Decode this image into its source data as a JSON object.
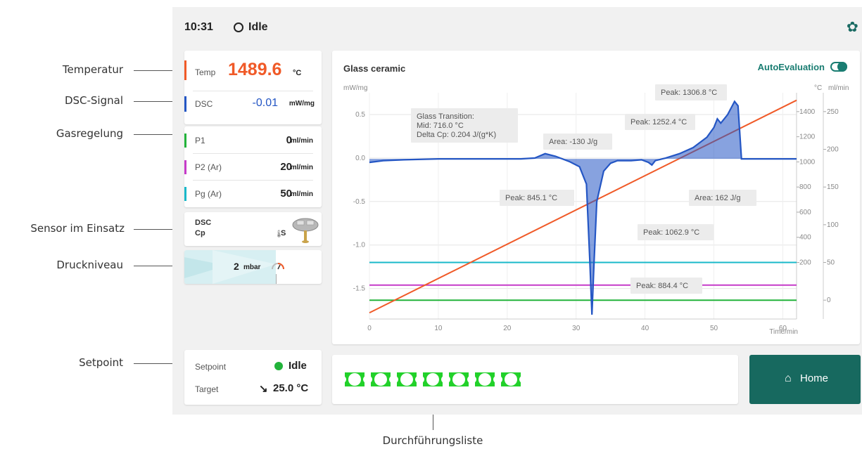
{
  "annotations": {
    "temperatur": "Temperatur",
    "dsc_signal": "DSC-Signal",
    "gasregelung": "Gasregelung",
    "sensor": "Sensor im Einsatz",
    "druckniveau": "Druckniveau",
    "setpoint": "Setpoint",
    "durchfuehrungsliste": "Durchführungsliste"
  },
  "status": {
    "time": "10:31",
    "state": "Idle",
    "settings_icon": "gear-icon"
  },
  "temp": {
    "label": "Temp",
    "value": "1489.6",
    "unit": "°C",
    "color": "#f05a28"
  },
  "dsc": {
    "label": "DSC",
    "value": "-0.01",
    "unit": "mW/mg",
    "color": "#2456c4"
  },
  "gas": [
    {
      "label": "P1",
      "value": "0",
      "unit": "ml/min",
      "color": "#22b33a"
    },
    {
      "label": "P2 (Ar)",
      "value": "20",
      "unit": "ml/min",
      "color": "#c63bc9"
    },
    {
      "label": "Pg (Ar)",
      "value": "50",
      "unit": "ml/min",
      "color": "#19b8c9"
    }
  ],
  "sensor": {
    "line1": "DSC",
    "line2": "Cp",
    "type": "S",
    "thermo_icon": "thermometer-icon"
  },
  "pressure": {
    "value": "2",
    "unit": "mbar",
    "gauge_icon": "gauge-icon"
  },
  "setpoint": {
    "label": "Setpoint",
    "status": "Idle",
    "status_color": "#22b33a",
    "target_label": "Target",
    "target_value": "25.0 °C",
    "arrow": "↘"
  },
  "chart": {
    "title": "Glass ceramic",
    "auto_eval": "AutoEvaluation",
    "auto_eval_on": true
  },
  "chart_data": {
    "type": "line",
    "xlabel": "Time/min",
    "ylabel_left": "mW/mg",
    "ylabel_right_1": "°C",
    "ylabel_right_2": "ml/min",
    "xlim": [
      0,
      62
    ],
    "ylim_left": [
      -1.85,
      0.75
    ],
    "ylim_right_1": [
      -250,
      1550
    ],
    "ylim_right_2": [
      -25,
      275
    ],
    "x_ticks": [
      "0",
      "10",
      "20",
      "30",
      "40",
      "50",
      "60"
    ],
    "y_ticks_left": [
      "0.5",
      "0.0",
      "-0.5",
      "-1.0",
      "-1.5"
    ],
    "y_ticks_right_1": [
      "1400",
      "1200",
      "1000",
      "800",
      "600",
      "400",
      "200"
    ],
    "y_ticks_right_2": [
      "250",
      "200",
      "150",
      "100",
      "50",
      "0"
    ],
    "grid": true,
    "series": [
      {
        "color": "#2456c4",
        "axis": "left",
        "x": [
          0,
          2,
          5,
          10,
          15,
          20,
          22,
          24,
          25.5,
          27,
          29,
          30.5,
          31.5,
          32,
          32.3,
          32.6,
          33,
          34,
          35,
          36,
          38,
          39.5,
          40.5,
          41,
          41.5,
          43,
          45,
          47,
          49,
          50,
          50.5,
          51,
          52,
          53,
          53.5,
          54,
          56,
          60,
          62
        ],
        "y": [
          -0.05,
          -0.03,
          -0.02,
          -0.01,
          -0.01,
          -0.01,
          -0.01,
          0.0,
          0.05,
          0.02,
          -0.04,
          -0.1,
          -0.3,
          -1.2,
          -1.8,
          -1.2,
          -0.5,
          -0.15,
          -0.06,
          -0.03,
          -0.03,
          -0.02,
          -0.05,
          -0.08,
          -0.03,
          0.0,
          0.05,
          0.12,
          0.24,
          0.35,
          0.45,
          0.4,
          0.5,
          0.65,
          0.6,
          -0.01,
          -0.01,
          -0.01,
          -0.01
        ]
      },
      {
        "color": "#f05a28",
        "axis": "right_1",
        "x": [
          0,
          62
        ],
        "y": [
          -200,
          1490
        ]
      },
      {
        "color": "#19b8c9",
        "axis": "right_2",
        "x": [
          0,
          62
        ],
        "y": [
          50,
          50
        ]
      },
      {
        "color": "#c63bc9",
        "axis": "right_2",
        "x": [
          0,
          62
        ],
        "y": [
          20,
          20
        ]
      },
      {
        "color": "#22b33a",
        "axis": "right_2",
        "x": [
          0,
          62
        ],
        "y": [
          0,
          0
        ]
      }
    ],
    "fill": "#2456c4",
    "annotations": [
      {
        "text": "Glass Transition:\nMid: 716.0 °C\nDelta Cp: 0.204 J/(g*K)"
      },
      {
        "text": "Area: -130 J/g"
      },
      {
        "text": "Peak: 1252.4 °C"
      },
      {
        "text": "Peak: 1306.8 °C"
      },
      {
        "text": "Peak: 845.1 °C"
      },
      {
        "text": "Area: 162 J/g"
      },
      {
        "text": "Peak: 1062.9 °C"
      },
      {
        "text": "Peak: 884.4 °C"
      }
    ]
  },
  "queue": {
    "count": 7,
    "color": "#22d12a"
  },
  "home": {
    "label": "Home",
    "icon": "home-icon"
  }
}
